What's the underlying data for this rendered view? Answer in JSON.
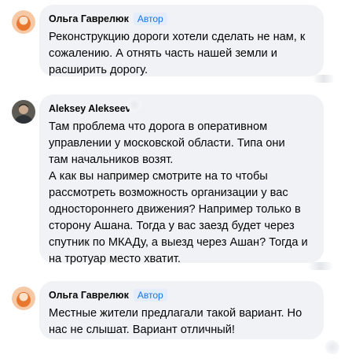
{
  "comments": [
    {
      "author": "Ольга Гаврелюк",
      "badge": "Автор",
      "text": "Реконструкцию дороги хотели сделать не нам, к\nсожалению. А отнять часть нашей земли и\nрасширить дорогу."
    },
    {
      "author": "Aleksey Alekseev",
      "text": "Там проблема что дорога в оперативном\nуправлении у московской области. Типа они\nтам начальников возят.\nА как вы например смотрите на то чтобы\nрассмотреть возможность организации у вас\nодностороннего движения? Например только в\nсторону Ашана. Тогда у вас заезд будет через\nспутник по МКАДу, а выезд через Ашан? Тогда и\nна тротуар место хватит."
    },
    {
      "author": "Ольга Гаврелюк",
      "badge": "Автор",
      "text": "Местные жители предлагали такой вариант. Но\nнас не слышат. Вариант отличный!"
    }
  ],
  "colors": {
    "bubble_bg": "#f0f2f5",
    "badge_text": "#1b74e4",
    "badge_bg": "#e3edfb"
  },
  "icons": [
    "orange-avatar-icon",
    "male-photo-avatar-icon"
  ]
}
